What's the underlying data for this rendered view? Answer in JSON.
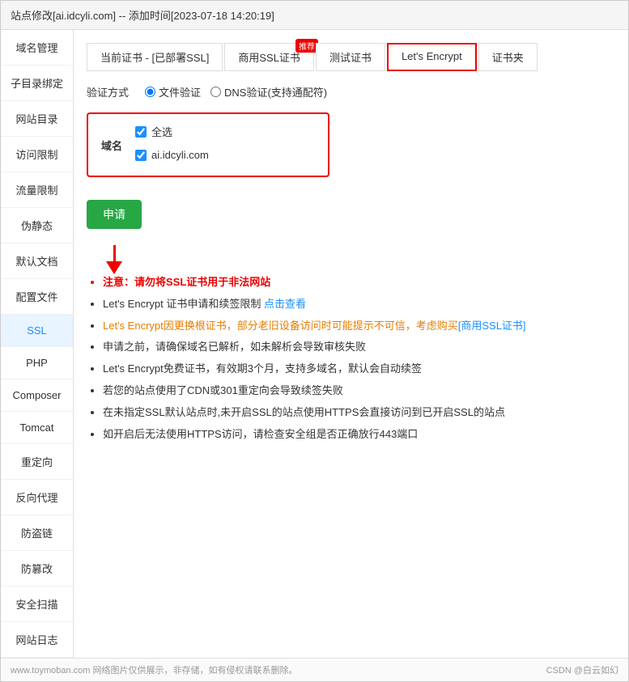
{
  "title": "站点修改[ai.idcyli.com] -- 添加时间[2023-07-18 14:20:19]",
  "sidebar": {
    "items": [
      {
        "label": "域名管理",
        "active": false
      },
      {
        "label": "子目录绑定",
        "active": false
      },
      {
        "label": "网站目录",
        "active": false
      },
      {
        "label": "访问限制",
        "active": false
      },
      {
        "label": "流量限制",
        "active": false
      },
      {
        "label": "伪静态",
        "active": false
      },
      {
        "label": "默认文档",
        "active": false
      },
      {
        "label": "配置文件",
        "active": false
      },
      {
        "label": "SSL",
        "active": true
      },
      {
        "label": "PHP",
        "active": false
      },
      {
        "label": "Composer",
        "active": false
      },
      {
        "label": "Tomcat",
        "active": false
      },
      {
        "label": "重定向",
        "active": false
      },
      {
        "label": "反向代理",
        "active": false
      },
      {
        "label": "防盗链",
        "active": false
      },
      {
        "label": "防篡改",
        "active": false
      },
      {
        "label": "安全扫描",
        "active": false
      },
      {
        "label": "网站日志",
        "active": false
      }
    ]
  },
  "tabs": [
    {
      "label": "当前证书 - [已部署SSL]",
      "active": false,
      "badge": ""
    },
    {
      "label": "商用SSL证书",
      "active": false,
      "badge": "推荐"
    },
    {
      "label": "测试证书",
      "active": false,
      "badge": ""
    },
    {
      "label": "Let's Encrypt",
      "active": true,
      "badge": ""
    },
    {
      "label": "证书夹",
      "active": false,
      "badge": ""
    }
  ],
  "verify": {
    "label": "验证方式",
    "options": [
      {
        "value": "file",
        "label": "文件验证",
        "checked": true
      },
      {
        "value": "dns",
        "label": "DNS验证(支持通配符)",
        "checked": false
      }
    ]
  },
  "domain_section": {
    "label": "域名",
    "select_all": "全选",
    "domain": "ai.idcyli.com"
  },
  "apply_button": "申请",
  "notes": [
    {
      "text": "注意：请勿将SSL证书用于非法网站",
      "class": "warning"
    },
    {
      "text_parts": [
        {
          "text": "Let's Encrypt 证书申请和续签限制 ",
          "class": ""
        },
        {
          "text": "点击查看",
          "class": "link"
        }
      ]
    },
    {
      "text_parts": [
        {
          "text": "Let's Encrypt因更换根证书，部分老旧设备访问时可能提示不可信，考虑购买",
          "class": "orange"
        },
        {
          "text": "[商用SSL证书]",
          "class": "blue-link"
        }
      ]
    },
    {
      "text": "申请之前，请确保域名已解析，如未解析会导致审核失败",
      "class": ""
    },
    {
      "text": "Let's Encrypt免费证书，有效期3个月，支持多域名，默认会自动续签",
      "class": ""
    },
    {
      "text": "若您的站点使用了CDN或301重定向会导致续签失败",
      "class": ""
    },
    {
      "text": "在未指定SSL默认站点时,未开启SSL的站点使用HTTPS会直接访问到已开启SSL的站点",
      "class": ""
    },
    {
      "text": "如开启后无法使用HTTPS访问，请检查安全组是否正确放行443端口",
      "class": ""
    }
  ],
  "footer": {
    "left": "www.toymoban.com 网络图片仅供展示，非存储，如有侵权请联系删除。",
    "right": "CSDN @白云如幻"
  }
}
